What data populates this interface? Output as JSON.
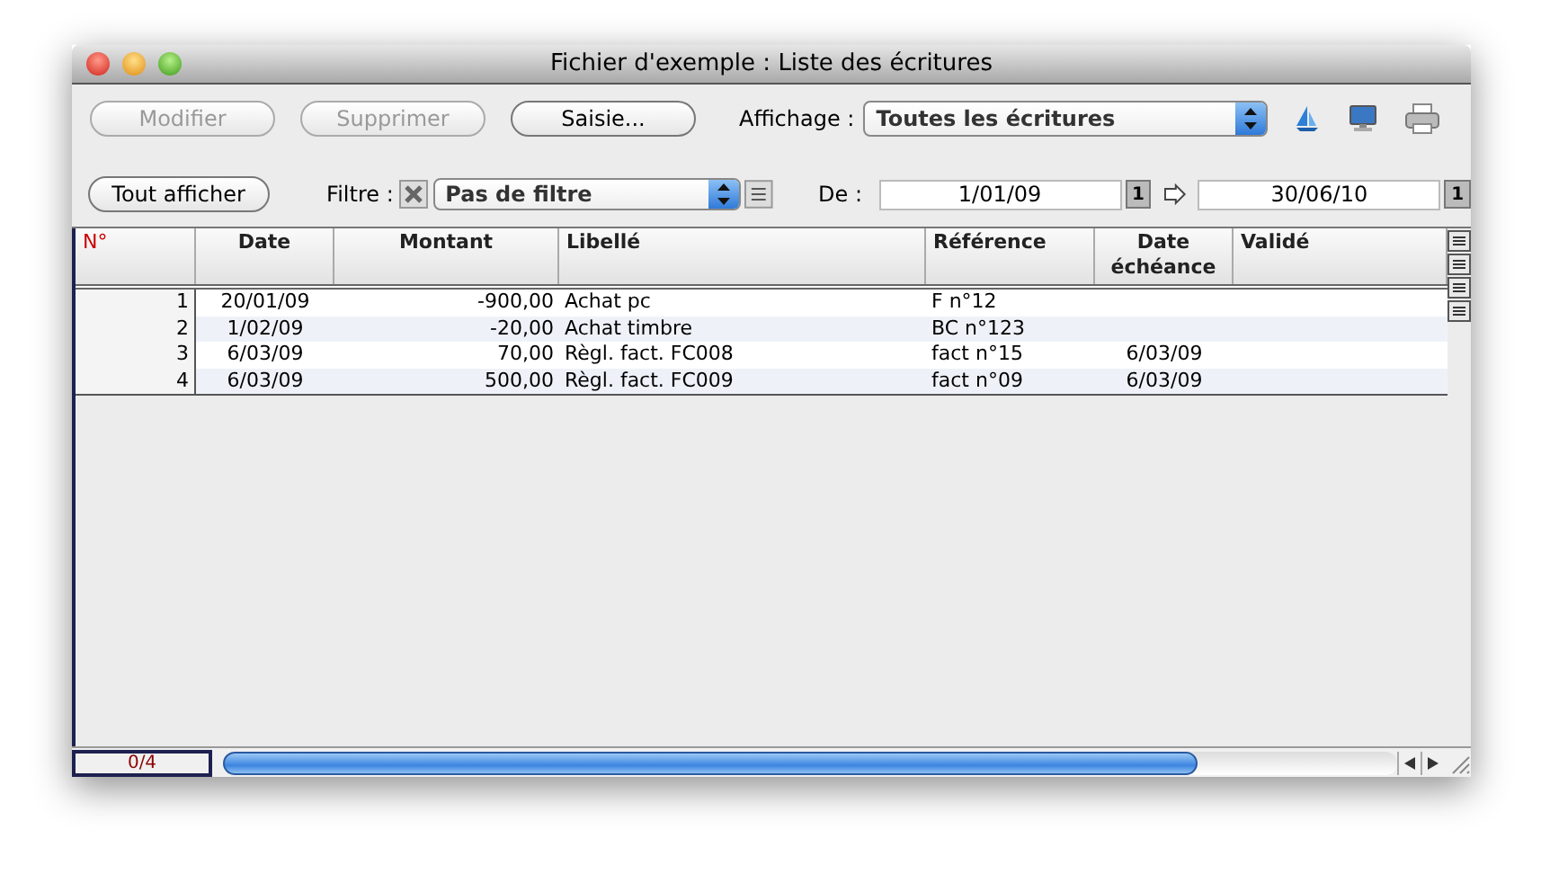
{
  "window": {
    "title": "Fichier d'exemple : Liste des écritures"
  },
  "toolbar": {
    "buttons": [
      {
        "label": "Modifier",
        "disabled": true
      },
      {
        "label": "Supprimer",
        "disabled": true
      },
      {
        "label": "Saisie...",
        "disabled": false
      }
    ],
    "display_label": "Affichage :",
    "display_value": "Toutes les écritures"
  },
  "filter_bar": {
    "show_all": "Tout afficher",
    "filter_label": "Filtre :",
    "filter_value": "Pas de filtre",
    "from_label": "De :",
    "from_date": "1/01/09",
    "from_step": "1",
    "to_date": "30/06/10",
    "to_step": "1"
  },
  "table": {
    "columns": [
      {
        "label": "N°",
        "sorted": true
      },
      {
        "label": "Date",
        "sorted": false
      },
      {
        "label": "Montant",
        "sorted": false
      },
      {
        "label": "Libellé",
        "sorted": false
      },
      {
        "label": "Référence",
        "sorted": false
      },
      {
        "label": "Date\néchéance",
        "sorted": false
      },
      {
        "label": "Validé",
        "sorted": false
      }
    ],
    "rows": [
      [
        "1",
        "20/01/09",
        "-900,00",
        "Achat pc",
        "F n°12",
        "",
        ""
      ],
      [
        "2",
        "1/02/09",
        "-20,00",
        "Achat timbre",
        "BC n°123",
        "",
        ""
      ],
      [
        "3",
        "6/03/09",
        "70,00",
        "Règl. fact. FC008",
        "fact n°15",
        "6/03/09",
        ""
      ],
      [
        "4",
        "6/03/09",
        "500,00",
        "Règl. fact. FC009",
        "fact n°09",
        "6/03/09",
        ""
      ]
    ]
  },
  "status_bar": {
    "count": "0/4"
  }
}
